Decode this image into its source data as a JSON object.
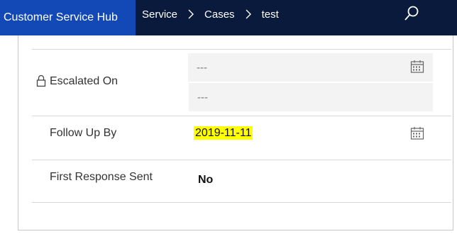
{
  "header": {
    "app_title": "Customer Service Hub",
    "breadcrumb": [
      "Service",
      "Cases",
      "test"
    ],
    "search_icon": "search-icon",
    "brand_color": "#1349b7",
    "bar_color": "#0a1a3c"
  },
  "fields": {
    "escalated_on": {
      "label": "Escalated On",
      "date_value": "---",
      "time_value": "---",
      "locked": true
    },
    "follow_up_by": {
      "label": "Follow Up By",
      "value": "2019-11-11",
      "highlight_color": "#ffff00"
    },
    "first_response_sent": {
      "label": "First Response Sent",
      "value": "No"
    }
  }
}
